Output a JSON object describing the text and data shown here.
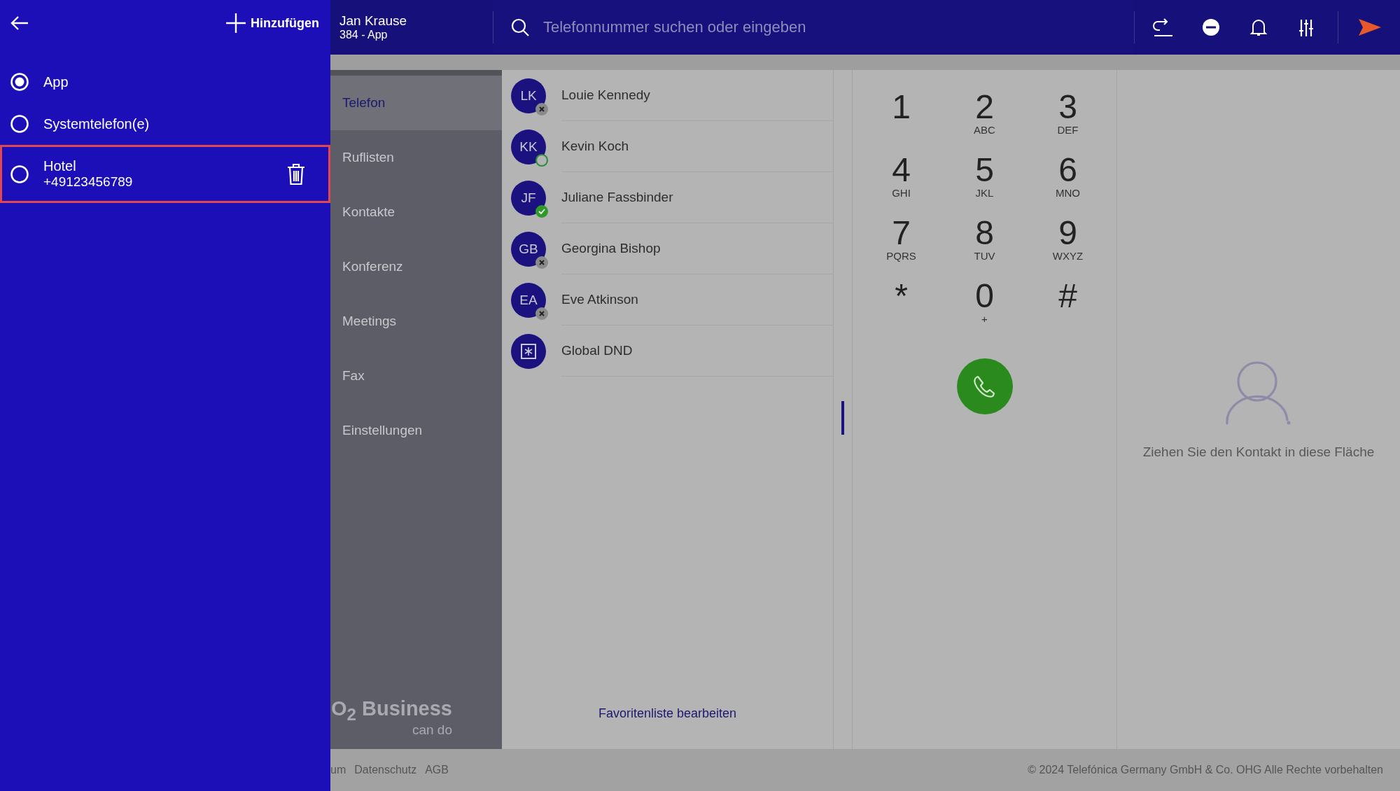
{
  "drawer": {
    "add_label": "Hinzufügen",
    "items": [
      {
        "label": "App",
        "selected": true,
        "focused": false,
        "deletable": false
      },
      {
        "label": "Systemtelefon(e)",
        "selected": false,
        "focused": false,
        "deletable": false
      },
      {
        "label": "Hotel",
        "number": "+49123456789",
        "selected": false,
        "focused": true,
        "deletable": true
      }
    ]
  },
  "topbar": {
    "user_name": "Jan Krause",
    "user_line": "384 - App",
    "search": {
      "placeholder": "Telefonnummer suchen oder eingeben"
    }
  },
  "nav": {
    "items": [
      {
        "label": "Telefon",
        "selected": true
      },
      {
        "label": "Ruflisten",
        "selected": false
      },
      {
        "label": "Kontakte",
        "selected": false
      },
      {
        "label": "Konferenz",
        "selected": false
      },
      {
        "label": "Meetings",
        "selected": false
      },
      {
        "label": "Fax",
        "selected": false
      },
      {
        "label": "Einstellungen",
        "selected": false
      }
    ],
    "logo": {
      "brand": "O$_{2}$ Business",
      "tagline": "can do"
    }
  },
  "favorites": {
    "contacts": [
      {
        "kind": "person",
        "initials": "LK",
        "name": "Louie Kennedy",
        "badge": {
          "kind": "offline"
        }
      },
      {
        "kind": "person",
        "initials": "KK",
        "name": "Kevin Koch",
        "badge": {
          "kind": "idle"
        }
      },
      {
        "kind": "person",
        "initials": "JF",
        "name": "Juliane Fassbinder",
        "badge": {
          "kind": "available"
        }
      },
      {
        "kind": "person",
        "initials": "GB",
        "name": "Georgina Bishop",
        "badge": {
          "kind": "offline"
        }
      },
      {
        "kind": "person",
        "initials": "EA",
        "name": "Eve Atkinson",
        "badge": {
          "kind": "offline"
        }
      },
      {
        "kind": "dnd",
        "name": "Global DND"
      }
    ],
    "edit_link": "Favoritenliste bearbeiten"
  },
  "dialpad": {
    "keys": [
      {
        "digit": "1"
      },
      {
        "digit": "2",
        "letters": "ABC"
      },
      {
        "digit": "3",
        "letters": "DEF"
      },
      {
        "digit": "4",
        "letters": "GHI"
      },
      {
        "digit": "5",
        "letters": "JKL"
      },
      {
        "digit": "6",
        "letters": "MNO"
      },
      {
        "digit": "7",
        "letters": "PQRS"
      },
      {
        "digit": "8",
        "letters": "TUV"
      },
      {
        "digit": "9",
        "letters": "WXYZ"
      },
      {
        "digit": "*"
      },
      {
        "digit": "0",
        "letters": "+"
      },
      {
        "digit": "#"
      }
    ]
  },
  "dropzone": {
    "hint": "Ziehen Sie den Kontakt in diese Fläche"
  },
  "footer": {
    "links": [
      "um",
      "Datenschutz",
      "AGB"
    ],
    "copyright": "© 2024 Telefónica Germany GmbH & Co. OHG Alle Rechte vorbehalten"
  }
}
